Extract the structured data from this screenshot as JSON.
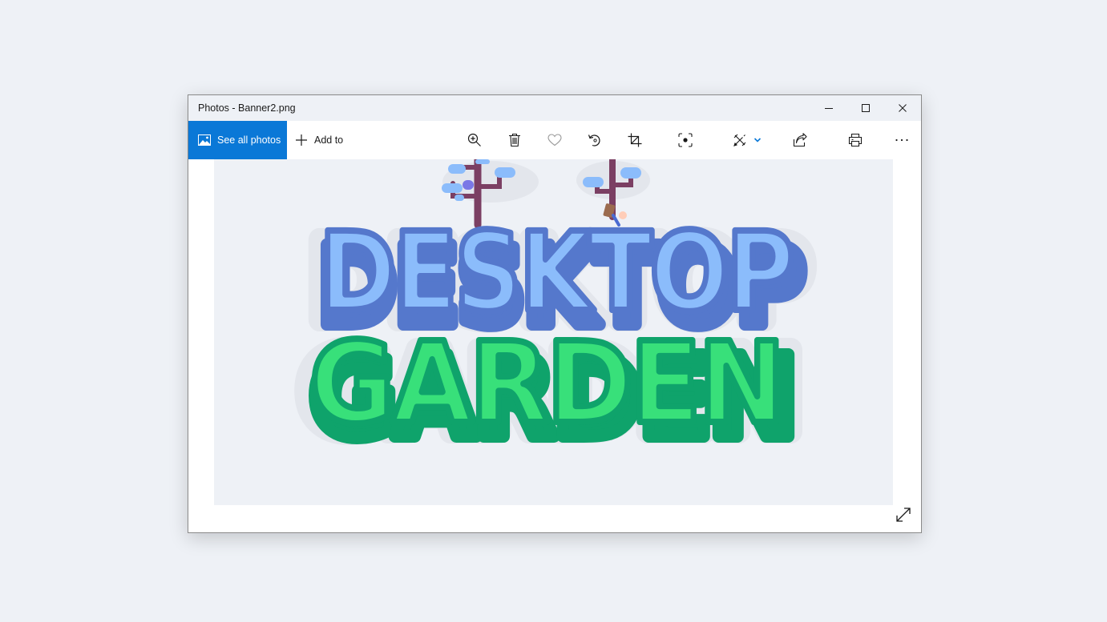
{
  "window": {
    "title": "Photos - Banner2.png"
  },
  "toolbar": {
    "see_all_photos": "See all photos",
    "add_to": "Add to",
    "icons": [
      "zoom-in-icon",
      "delete-icon",
      "heart-icon",
      "rotate-icon",
      "crop-icon",
      "enhance-icon",
      "edit-draw-icon",
      "share-icon",
      "print-icon",
      "more-icon"
    ]
  },
  "image": {
    "line1": "DESKTOP",
    "line2": "GARDEN",
    "colors": {
      "background": "#eef1f6",
      "line1_fill": "#8bbcfb",
      "line1_shadow": "#5578cc",
      "line2_fill": "#38e07a",
      "line2_shadow": "#0fa36b",
      "stem": "#7b3f63",
      "leaf": "#8bbcfb"
    }
  },
  "accent": "#0a78d7"
}
